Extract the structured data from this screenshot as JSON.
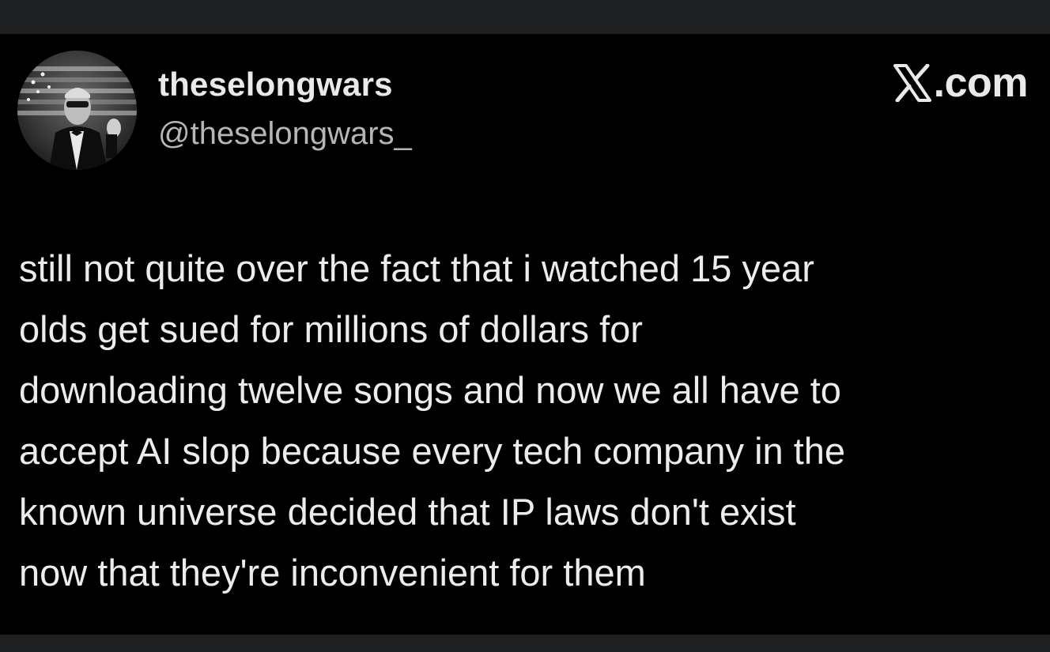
{
  "post": {
    "author": {
      "display_name": "theselongwars",
      "handle": "@theselongwars_",
      "avatar_icon": "profile-photo"
    },
    "brand": {
      "icon": "x-logo-icon",
      "text": ".com"
    },
    "body_lines": [
      "still not quite over the fact that i watched 15 year",
      "olds get sued for millions of dollars for",
      "downloading twelve songs and now we all have to",
      "accept AI slop because every tech company in the",
      "known universe decided that IP laws don't exist",
      "now that they're inconvenient for them"
    ]
  },
  "colors": {
    "card_background": "#000000",
    "frame_background": "#1f2123",
    "name_color": "#e7e9ea",
    "handle_color": "#b4b7ba",
    "text_color": "#ececec"
  }
}
